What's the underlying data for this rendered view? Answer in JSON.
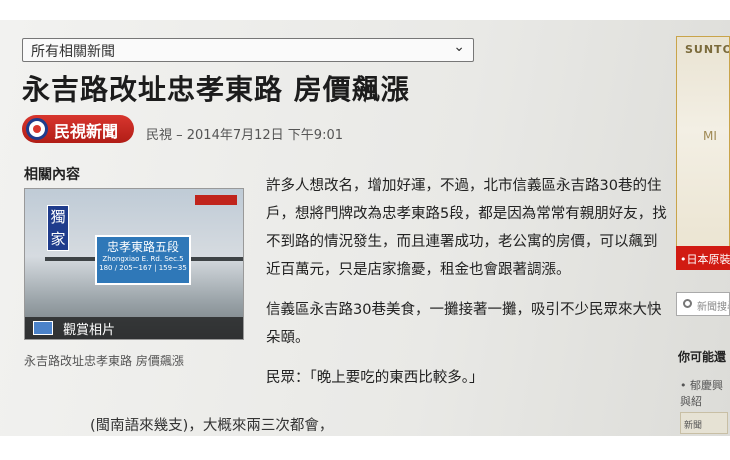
{
  "dropdown": {
    "value": "所有相關新聞"
  },
  "article": {
    "headline": "永吉路改址忠孝東路 房價飆漲",
    "source_logo": "民視新聞",
    "byline": "民視 – 2014年7月12日 下午9:01",
    "paragraphs": [
      "許多人想改名，增加好運，不過，北市信義區永吉路30巷的住戶，想將門牌改為忠孝東路5段，都是因為常常有親朋好友，找不到路的情況發生，而且連署成功，老公寓的房價，可以飆到近百萬元，只是店家擔憂，租金也會跟著調漲。",
      "信義區永吉路30巷美食，一攤接著一攤，吸引不少民眾來大快朵頤。",
      "民眾：「晚上要吃的東西比較多。」"
    ],
    "cut_line": "(閩南語來幾支)，大概來兩三次都會，"
  },
  "related": {
    "label": "相關內容",
    "photo": {
      "tag": "獨家",
      "street_sign": "忠孝東路五段",
      "street_sign_sub": "Zhongxiao E. Rd. Sec.5",
      "numbers": "180 / 205~167 | 159~35",
      "view_button": "觀賞相片"
    },
    "caption": "永吉路改址忠孝東路 房價飆漲"
  },
  "sidebar": {
    "ad_brand": "SUNTORY",
    "ad_mi": "MI",
    "ad_band": "•日本原裝",
    "search_placeholder": "新聞搜尋",
    "maybe_title": "你可能還",
    "link": "• 郁慶興與紹",
    "bottom_label": "新聞"
  },
  "colors": {
    "logo_red": "#c72a22",
    "logo_blue": "#1f3c8c",
    "sign_blue": "#2f78b8",
    "ad_gold": "#c9a44a"
  }
}
